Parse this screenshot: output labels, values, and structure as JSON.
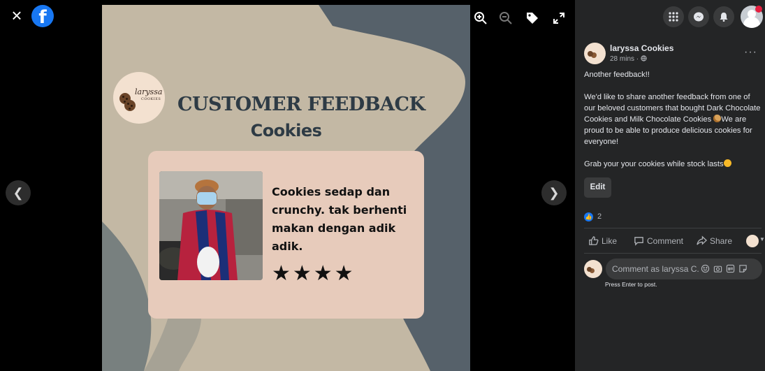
{
  "viewer": {
    "close_icon": "close-icon",
    "logo_icon": "facebook-logo-icon",
    "logo_glyph": "f",
    "prev_icon": "chevron-left-icon",
    "next_icon": "chevron-right-icon",
    "tools": [
      "zoom-in-icon",
      "zoom-out-icon",
      "tag-icon",
      "fullscreen-icon"
    ]
  },
  "image": {
    "brand_script": "laryssa",
    "brand_sub": "COOKIES",
    "title": "CUSTOMER FEEDBACK",
    "subtitle": "Cookies",
    "quote": "Cookies sedap dan crunchy. tak berhenti makan dengan adik adik.",
    "stars": "★★★★",
    "rating": 4
  },
  "topbar": {
    "buttons": [
      "menu-grid-icon",
      "messenger-icon",
      "notifications-icon",
      "account-avatar"
    ]
  },
  "post": {
    "author": "laryssa Cookies",
    "time": "28 mins · ",
    "privacy_icon": "globe-icon",
    "menu": "···",
    "body": {
      "line1": "Another feedback!!",
      "line2a": "We'd like to share another feedback from one of our beloved customers that bought Dark Chocolate Cookies and Milk Chocolate Cookies ",
      "line2b": "We are proud to be able to produce delicious cookies for everyone!",
      "line3": "Grab your your cookies while stock lasts"
    },
    "edit_label": "Edit",
    "reaction_count": "2",
    "actions": {
      "like": "Like",
      "comment": "Comment",
      "share": "Share"
    },
    "comment_placeholder": "Comment as laryssa C...",
    "comment_hint": "Press Enter to post."
  },
  "colors": {
    "accent": "#1877f2",
    "panel_bg": "#242526",
    "card_bg": "#e7cbbb",
    "title_color": "#2e3b45"
  }
}
